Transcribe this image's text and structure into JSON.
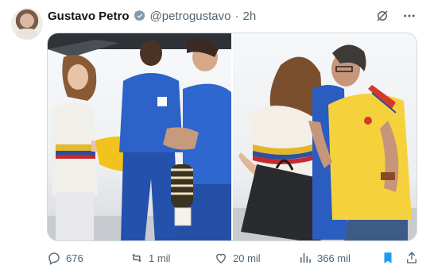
{
  "post": {
    "author_name": "Gustavo Petro",
    "handle": "@petrogustavo",
    "separator": "·",
    "time": "2h"
  },
  "actions": {
    "replies": "676",
    "reposts": "1 mil",
    "likes": "20 mil",
    "views": "366 mil"
  },
  "icons": [
    "avatar",
    "verified-badge-icon",
    "grok-icon",
    "more-icon",
    "reply-icon",
    "repost-icon",
    "like-icon",
    "views-icon",
    "bookmark-icon",
    "share-icon"
  ],
  "colors": {
    "bookmark": "#1d9bf0",
    "muted": "#536471",
    "verified": "#829aab"
  }
}
